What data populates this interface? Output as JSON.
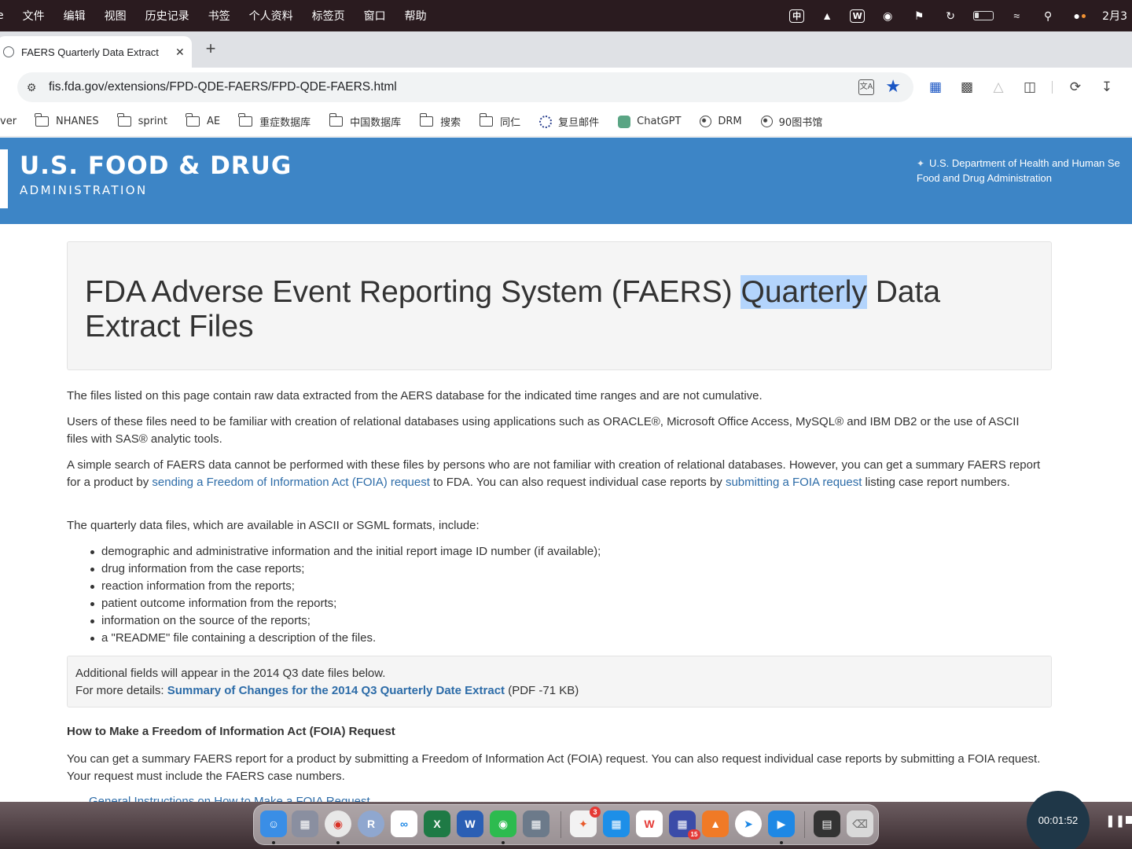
{
  "menubar": {
    "items": [
      "e",
      "文件",
      "编辑",
      "视图",
      "历史记录",
      "书签",
      "个人资料",
      "标签页",
      "窗口",
      "帮助"
    ],
    "right": {
      "input_method": "中",
      "wps_w": "W",
      "date": "2月3"
    }
  },
  "tab": {
    "title": "FAERS Quarterly Data Extract",
    "close": "✕",
    "new_tab": "+"
  },
  "toolbar": {
    "url": "fis.fda.gov/extensions/FPD-QDE-FAERS/FPD-QDE-FAERS.html"
  },
  "bookmarks": [
    {
      "label": "ver",
      "icon": "none"
    },
    {
      "label": "NHANES",
      "icon": "folder-icon"
    },
    {
      "label": "sprint",
      "icon": "folder-icon"
    },
    {
      "label": "AE",
      "icon": "folder-icon"
    },
    {
      "label": "重症数据库",
      "icon": "folder-icon"
    },
    {
      "label": "中国数据库",
      "icon": "folder-icon"
    },
    {
      "label": "搜索",
      "icon": "folder-icon"
    },
    {
      "label": "同仁",
      "icon": "folder-icon"
    },
    {
      "label": "复旦邮件",
      "icon": "fudan-icon"
    },
    {
      "label": "ChatGPT",
      "icon": "chatgpt-icon"
    },
    {
      "label": "DRM",
      "icon": "globe-icon"
    },
    {
      "label": "90图书馆",
      "icon": "globe-icon"
    }
  ],
  "banner": {
    "title": "U.S. FOOD & DRUG",
    "subtitle": "ADMINISTRATION",
    "hhs_line1": "U.S. Department of Health and Human Se",
    "hhs_line2": "Food and Drug Administration"
  },
  "page": {
    "title_before": "FDA Adverse Event Reporting System (FAERS) ",
    "title_highlight": "Quarterly",
    "title_after": " Data Extract Files",
    "p1": "The files listed on this page contain raw data extracted from the AERS database for the indicated time ranges and are not cumulative.",
    "p2": "Users of these files need to be familiar with creation of relational databases using applications such as ORACLE®, Microsoft Office Access, MySQL® and IBM DB2 or the use of ASCII files with SAS® analytic tools.",
    "p3_a": "A simple search of FAERS data cannot be performed with these files by persons who are not familiar with creation of relational databases. However, you can get a summary FAERS report for a product by ",
    "p3_link1": "sending a Freedom of Information Act (FOIA) request",
    "p3_b": " to FDA. You can also request individual case reports by ",
    "p3_link2": "submitting a FOIA request",
    "p3_c": " listing case report numbers.",
    "p4": "The quarterly data files, which are available in ASCII or SGML formats, include:",
    "list": [
      "demographic and administrative information and the initial report image ID number (if available);",
      "drug information from the case reports;",
      "reaction information from the reports;",
      "patient outcome information from the reports;",
      "information on the source of the reports;",
      "a \"README\" file containing a description of the files."
    ],
    "well_line1": "Additional fields will appear in the 2014 Q3 date files below.",
    "well_prefix": "For more details: ",
    "well_link": "Summary of Changes for the 2014 Q3 Quarterly Date Extract",
    "well_suffix": " (PDF -71 KB)",
    "foia_heading": "How to Make a Freedom of Information Act (FOIA) Request",
    "foia_p": "You can get a summary FAERS report for a product by submitting a Freedom of Information Act (FOIA) request. You can also request individual case reports by submitting a FOIA request. Your request must include the FAERS case numbers.",
    "partial_link": "General Instructions on How to Make a FOIA Request"
  },
  "dock": {
    "timer": "00:01:52",
    "badges": {
      "appstore": "3",
      "calendar": "15"
    }
  },
  "colors": {
    "fda_blue": "#3d85c6",
    "link": "#2d6ca8",
    "highlight": "#b3d4fc"
  }
}
